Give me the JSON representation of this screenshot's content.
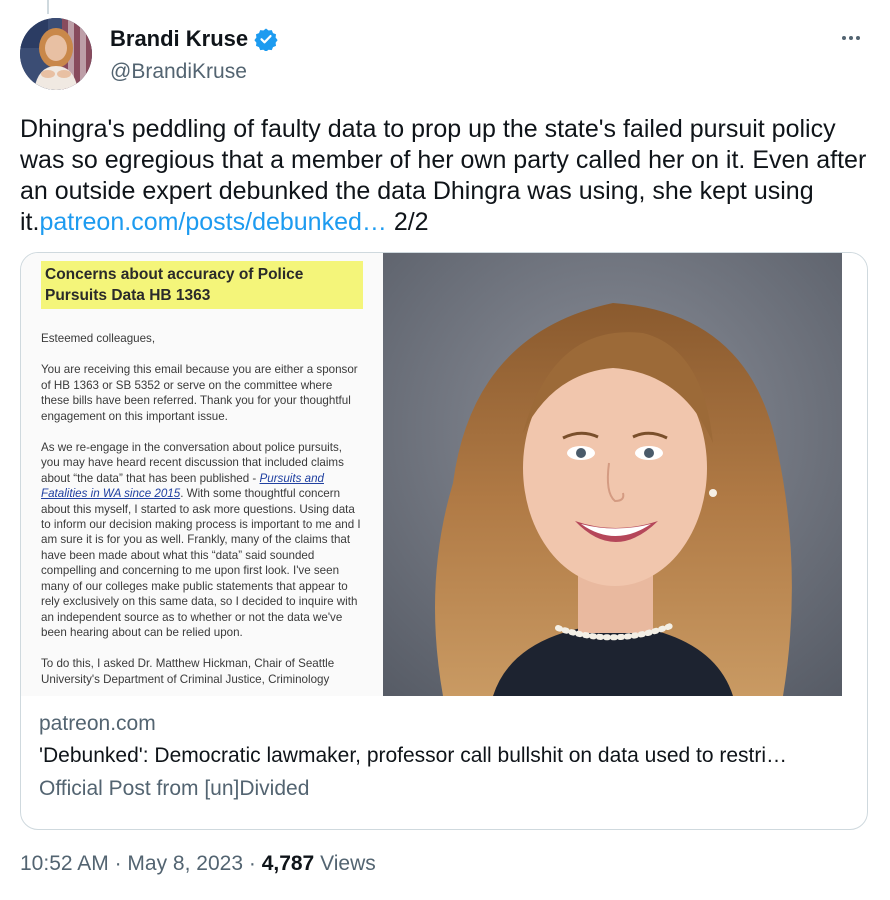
{
  "author": {
    "display_name": "Brandi Kruse",
    "handle": "@BrandiKruse",
    "verified_icon": "verified-badge-icon",
    "more_icon": "more-icon"
  },
  "tweet": {
    "text_before_link": "Dhingra's peddling of faulty data to prop up the state's failed pursuit policy was so egregious that a member of her own party called her on it. Even after an outside expert debunked the data Dhingra was using, she kept using it.",
    "link_text": "patreon.com/posts/debunked…",
    "text_after_link": " 2/2"
  },
  "card": {
    "document": {
      "title": "Concerns about accuracy of Police Pursuits Data HB 1363",
      "greeting": "Esteemed colleagues,",
      "paragraph_1": "You are receiving this email because you are either a sponsor of HB 1363 or SB 5352 or serve on the committee where these bills have been referred. Thank you for your thoughtful engagement on this important issue.",
      "paragraph_2_a": "As we re-engage in the conversation about police pursuits, you may have heard recent discussion that included claims about “the data” that has been published - ",
      "paragraph_2_link": "Pursuits and Fatalities in WA since 2015",
      "paragraph_2_b": ". With some thoughtful concern about this myself, I started to ask more questions. Using data to inform our decision making process is important to me and I am sure it is for you as well. Frankly, many of the claims that have been made about what this “data” said sounded compelling and concerning to me upon first look. I've seen many of our colleges make public statements that appear to rely exclusively on this same data, so I decided to inquire with an independent source as to whether or not the data we've been hearing about can be relied upon.",
      "paragraph_3": "To do this, I asked Dr. Matthew Hickman, Chair of Seattle University's Department of Criminal Justice, Criminology"
    },
    "domain": "patreon.com",
    "title": "'Debunked': Democratic lawmaker, professor call bullshit on data used to restri…",
    "description": "Official Post from [un]Divided"
  },
  "footer": {
    "time": "10:52 AM",
    "separator": "·",
    "date": "May 8, 2023",
    "views_count": "4,787",
    "views_label": "Views"
  },
  "colors": {
    "link": "#1d9bf0",
    "verified": "#1d9bf0",
    "secondary_text": "#536471",
    "border": "#cfd9de",
    "highlight": "#f4f57a"
  }
}
